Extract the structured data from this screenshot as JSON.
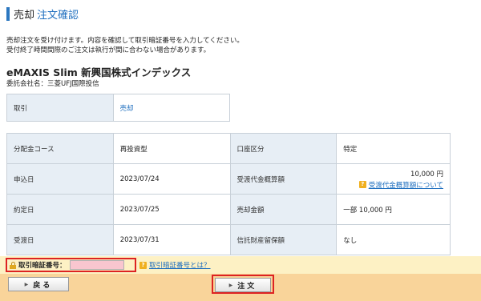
{
  "header": {
    "title_main": "売却",
    "title_sub": "注文確認"
  },
  "message": {
    "line1": "売却注文を受け付けます。内容を確認して取引暗証番号を入力してください。",
    "line2": "受付終了時間間際のご注文は執行が間に合わない場合があります。"
  },
  "fund": {
    "name": "eMAXIS Slim 新興国株式インデックス",
    "company": "委託会社名：三菱UFJ国際投信"
  },
  "trade_table": {
    "label": "取引",
    "value": "売却"
  },
  "detail_table": {
    "rows": [
      {
        "label1": "分配金コース",
        "value1": "再投資型",
        "label2": "口座区分",
        "value2": "特定"
      },
      {
        "label1": "申込日",
        "value1": "2023/07/24",
        "label2": "受渡代金概算額",
        "value2": "10,000 円",
        "value2_link": "受渡代金概算額について"
      },
      {
        "label1": "約定日",
        "value1": "2023/07/25",
        "label2": "売却金額",
        "value2": "一部 10,000 円"
      },
      {
        "label1": "受渡日",
        "value1": "2023/07/31",
        "label2": "信託財産留保額",
        "value2": "なし"
      }
    ]
  },
  "pin": {
    "label": "取引暗証番号：",
    "value": "",
    "placeholder": "",
    "help_link": "取引暗証番号とは？"
  },
  "buttons": {
    "back": "戻る",
    "order": "注文"
  },
  "colors": {
    "accent": "#1f6fbf",
    "highlight_border": "#dd2222",
    "pin_bg": "#f9c6cf",
    "button_bar": "#f9d49a"
  },
  "icons": {
    "lock": "lock-icon",
    "help": "question-icon",
    "arrow": "triangle-right-icon"
  }
}
